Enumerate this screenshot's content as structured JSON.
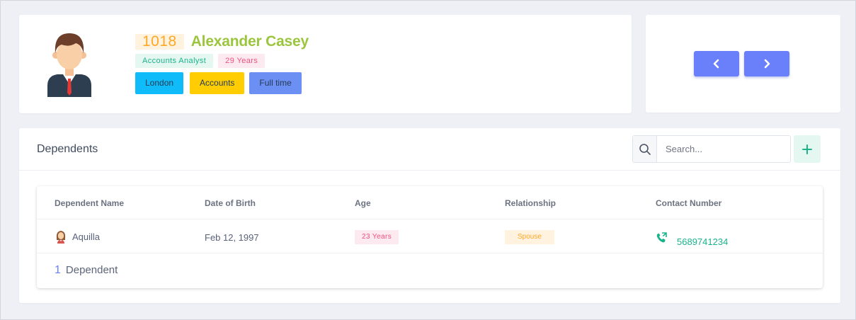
{
  "employee": {
    "id": "1018",
    "name": "Alexander Casey",
    "job_title": "Accounts Analyst",
    "age": "29 Years",
    "tags": [
      "London",
      "Accounts",
      "Full time"
    ]
  },
  "navigation": {
    "prev_icon": "chevron-left-icon",
    "next_icon": "chevron-right-icon"
  },
  "dependents": {
    "title": "Dependents",
    "search_placeholder": "Search...",
    "add_icon": "plus-icon",
    "columns": [
      "Dependent Name",
      "Date of Birth",
      "Age",
      "Relationship",
      "Contact Number"
    ],
    "rows": [
      {
        "name": "Aquilla",
        "dob": "Feb 12, 1997",
        "age": "23 Years",
        "relationship": "Spouse",
        "contact": "5689741234"
      }
    ],
    "count": "1",
    "count_label": "Dependent"
  },
  "colors": {
    "accent": "#6a7ffa",
    "success": "#1ab38a",
    "warning": "#ffa726",
    "danger": "#f0517e",
    "name": "#9bc53d"
  }
}
